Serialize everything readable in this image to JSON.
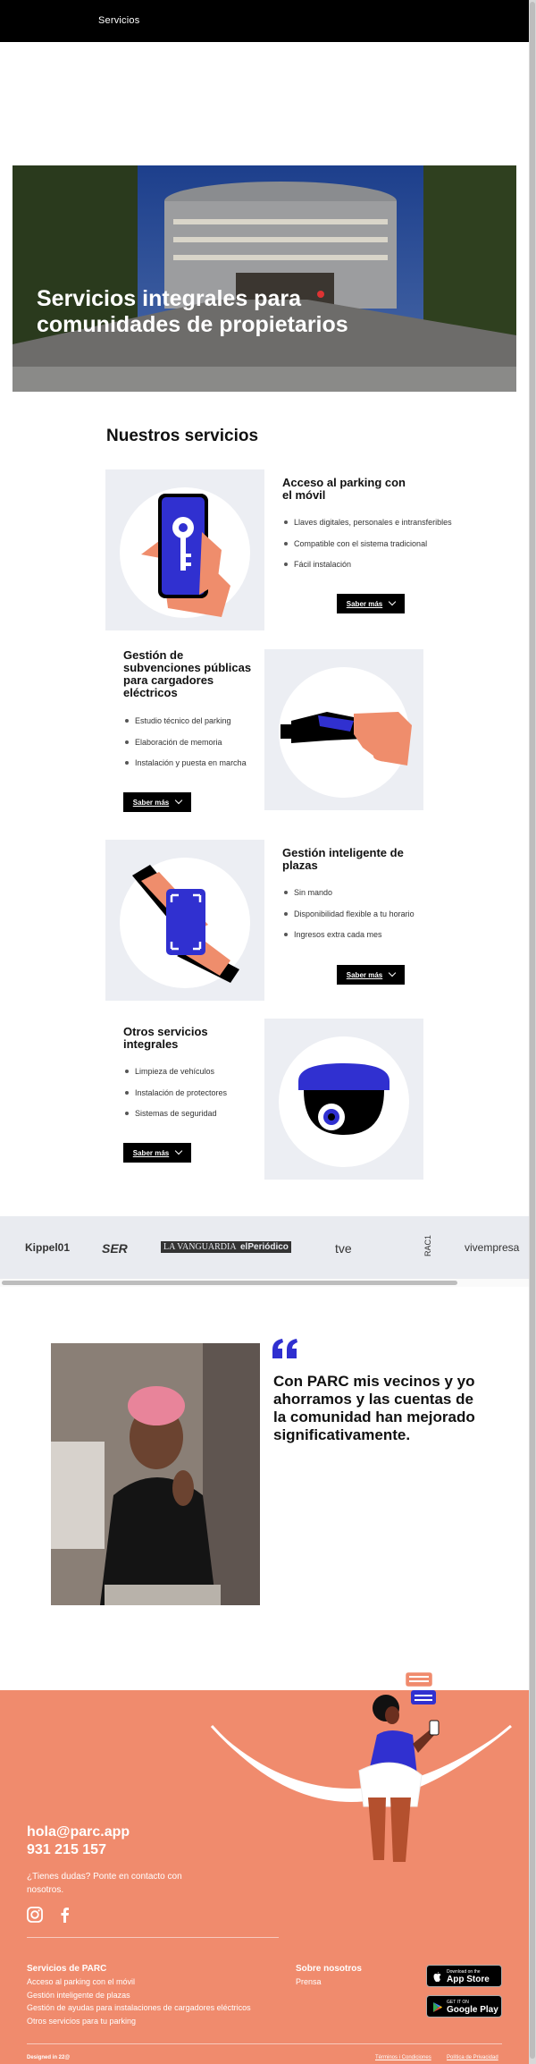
{
  "nav": {
    "link": "Servicios"
  },
  "hero": {
    "title": "Servicios integrales para comunidades de propietarios"
  },
  "services_section": {
    "title": "Nuestros servicios",
    "items": [
      {
        "title": "Acceso al parking con el móvil",
        "bullets": [
          "Llaves digitales, personales e intransferibles",
          "Compatible con el sistema tradicional",
          "Fácil instalación"
        ],
        "button": "Saber más",
        "icon": "phone-key-icon"
      },
      {
        "title": "Gestión de subvenciones públicas para cargadores eléctricos",
        "bullets": [
          "Estudio técnico del parking",
          "Elaboración de memoria",
          "Instalación y puesta en marcha"
        ],
        "button": "Saber más",
        "icon": "ev-charger-icon"
      },
      {
        "title": "Gestión inteligente de plazas",
        "bullets": [
          "Sin mando",
          "Disponibilidad flexible a tu horario",
          "Ingresos extra cada mes"
        ],
        "button": "Saber más",
        "icon": "parking-space-icon"
      },
      {
        "title": "Otros servicios integrales",
        "bullets": [
          "Limpieza de vehículos",
          "Instalación de protectores",
          "Sistemas de seguridad"
        ],
        "button": "Saber más",
        "icon": "security-camera-icon"
      }
    ]
  },
  "press": {
    "logos": [
      "Kippel01",
      "SER",
      "LA VANGUARDIA",
      "elPeriódico",
      "tve",
      "RAC1",
      "vivempresa"
    ]
  },
  "testimonial": {
    "quote": "Con PARC mis vecinos y yo ahorramos y las cuentas de la comunidad han mejorado significativamente."
  },
  "footer": {
    "email": "hola@parc.app",
    "phone": "931 215 157",
    "help": "¿Tienes dudas? Ponte en contacto con nosotros.",
    "services_title": "Servicios de PARC",
    "services_links": [
      "Acceso al parking con el móvil",
      "Gestión inteligente de plazas",
      "Gestión de ayudas para instalaciones de cargadores eléctricos",
      "Otros servicios para tu parking"
    ],
    "about_title": "Sobre nosotros",
    "about_links": [
      "Prensa"
    ],
    "app_store": {
      "small": "Download on the",
      "big": "App Store"
    },
    "google_play": {
      "small": "GET IT ON",
      "big": "Google Play"
    },
    "designed": "Designed in 22@",
    "terms": "Términos i Condiciones",
    "privacy": "Política de Privacidad"
  },
  "colors": {
    "accent_blue": "#2f2fd0",
    "coral": "#f08b6d",
    "panel_gray": "#eceef3"
  }
}
